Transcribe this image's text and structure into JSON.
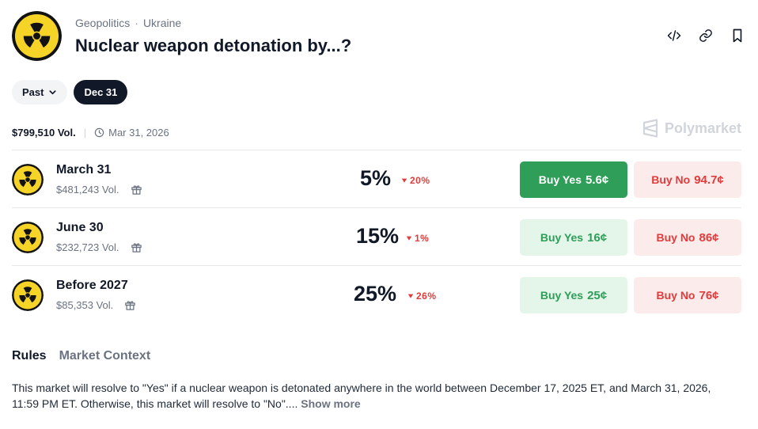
{
  "header": {
    "category": "Geopolitics",
    "separator": "·",
    "subcategory": "Ukraine",
    "title": "Nuclear weapon detonation by...?"
  },
  "header_icons": [
    "code-embed-icon",
    "link-icon",
    "bookmark-icon"
  ],
  "filters": {
    "past_label": "Past",
    "active_date": "Dec 31"
  },
  "meta": {
    "volume": "$799,510 Vol.",
    "separator": "|",
    "end_date": "Mar 31, 2026",
    "brand": "Polymarket"
  },
  "outcomes": [
    {
      "name": "March 31",
      "volume": "$481,243 Vol.",
      "probability": "5%",
      "change": "20%",
      "yes_label": "Buy Yes",
      "yes_price": "5.6¢",
      "no_label": "Buy No",
      "no_price": "94.7¢"
    },
    {
      "name": "June 30",
      "volume": "$232,723 Vol.",
      "probability": "15%",
      "change": "1%",
      "yes_label": "Buy Yes",
      "yes_price": "16¢",
      "no_label": "Buy No",
      "no_price": "86¢"
    },
    {
      "name": "Before 2027",
      "volume": "$85,353 Vol.",
      "probability": "25%",
      "change": "26%",
      "yes_label": "Buy Yes",
      "yes_price": "25¢",
      "no_label": "Buy No",
      "no_price": "76¢"
    }
  ],
  "tabs": [
    "Rules",
    "Market Context"
  ],
  "rules": {
    "text": "This market will resolve to \"Yes\" if a nuclear weapon is detonated anywhere in the world between December 17, 2025 ET, and March 31, 2026, 11:59 PM ET. Otherwise, this market will resolve to \"No\".... ",
    "show_more": "Show more"
  },
  "colors": {
    "yes_green": "#2f9e58",
    "yes_green_light": "#e3f6e9",
    "no_red": "#e23b3b",
    "no_red_light": "#fcebeb",
    "radiation_yellow": "#f5d327"
  }
}
